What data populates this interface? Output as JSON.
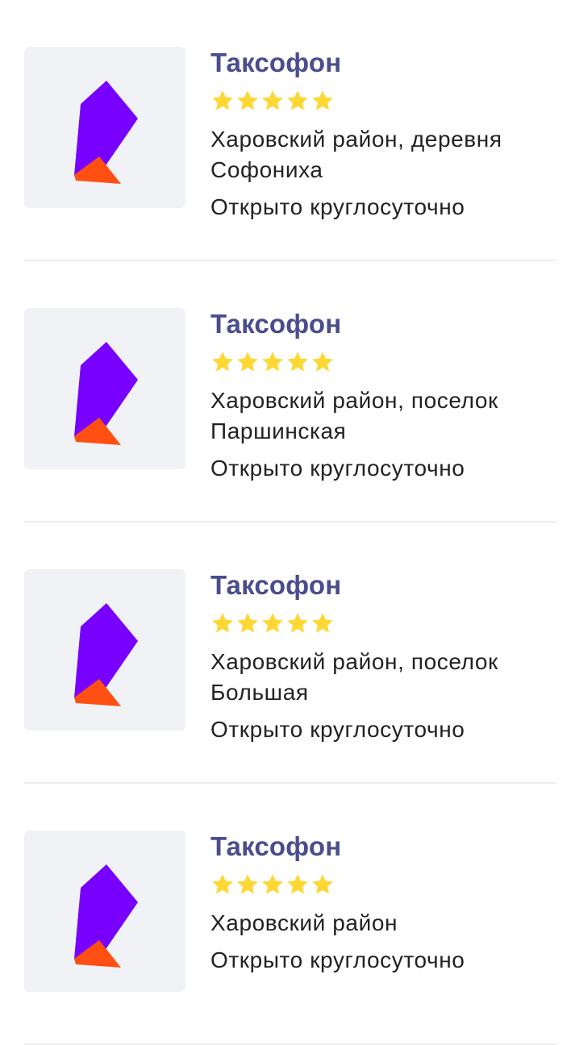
{
  "colors": {
    "title": "#4a4d8e",
    "star": "#fdd835",
    "logo_purple": "#7700ff",
    "logo_orange": "#ff4f12",
    "thumb_bg": "#f1f2f6",
    "divider": "#ececef"
  },
  "icons": {
    "thumbnail": "rostelecom-logo-icon",
    "rating": "star-icon"
  },
  "listings": [
    {
      "title": "Таксофон",
      "rating": 5,
      "rating_max": 5,
      "address_line1": "Харовский район, деревня",
      "address_line2": "Софониха",
      "hours": "Открыто круглосуточно"
    },
    {
      "title": "Таксофон",
      "rating": 5,
      "rating_max": 5,
      "address_line1": "Харовский район, поселок",
      "address_line2": "Паршинская",
      "hours": "Открыто круглосуточно"
    },
    {
      "title": "Таксофон",
      "rating": 5,
      "rating_max": 5,
      "address_line1": "Харовский район, поселок",
      "address_line2": "Большая",
      "hours": "Открыто круглосуточно"
    },
    {
      "title": "Таксофон",
      "rating": 5,
      "rating_max": 5,
      "address_line1": "Харовский район",
      "address_line2": "",
      "hours": "Открыто круглосуточно"
    }
  ]
}
